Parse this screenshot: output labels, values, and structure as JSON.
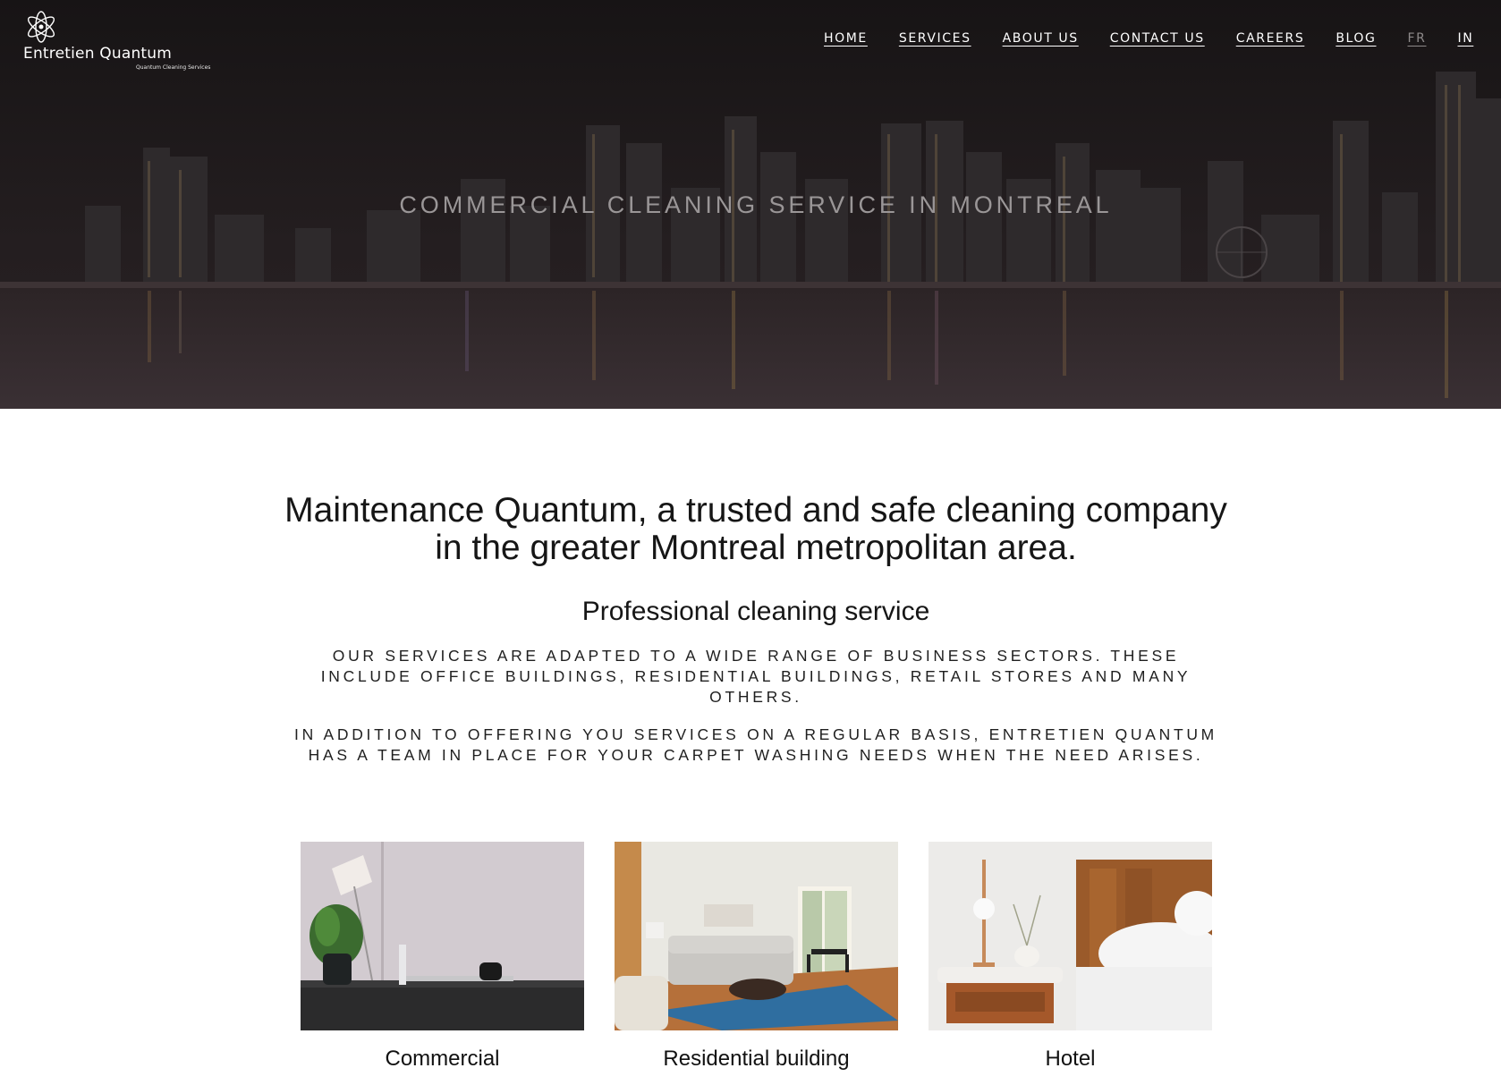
{
  "brand": {
    "name": "Entretien Quantum",
    "tagline": "Quantum Cleaning Services"
  },
  "nav": {
    "items": [
      "HOME",
      "SERVICES",
      "ABOUT US",
      "CONTACT US",
      "CAREERS",
      "BLOG",
      "FR",
      "IN"
    ]
  },
  "hero": {
    "title": "COMMERCIAL CLEANING SERVICE IN MONTREAL"
  },
  "main": {
    "heading": "Maintenance Quantum, a trusted and safe cleaning company in the greater Montreal metropolitan area.",
    "subheading": "Professional cleaning service",
    "paragraph1": "OUR SERVICES ARE ADAPTED TO A WIDE RANGE OF BUSINESS SECTORS. THESE INCLUDE OFFICE BUILDINGS, RESIDENTIAL BUILDINGS, RETAIL STORES AND MANY OTHERS.",
    "paragraph2": "IN ADDITION TO OFFERING YOU SERVICES ON A REGULAR BASIS, ENTRETIEN QUANTUM HAS A TEAM IN PLACE FOR YOUR CARPET WASHING NEEDS WHEN THE NEED ARISES."
  },
  "cards": [
    {
      "title": "Commercial",
      "image": "office-desk-image"
    },
    {
      "title": "Residential building",
      "image": "living-room-image"
    },
    {
      "title": "Hotel",
      "image": "hotel-bedroom-image"
    }
  ],
  "colors": {
    "hero_bg": "#1c1819",
    "nav_text": "#ffffff",
    "nav_muted": "#8e8a8a",
    "hero_title": "#9a9697",
    "body_text": "#161616"
  }
}
